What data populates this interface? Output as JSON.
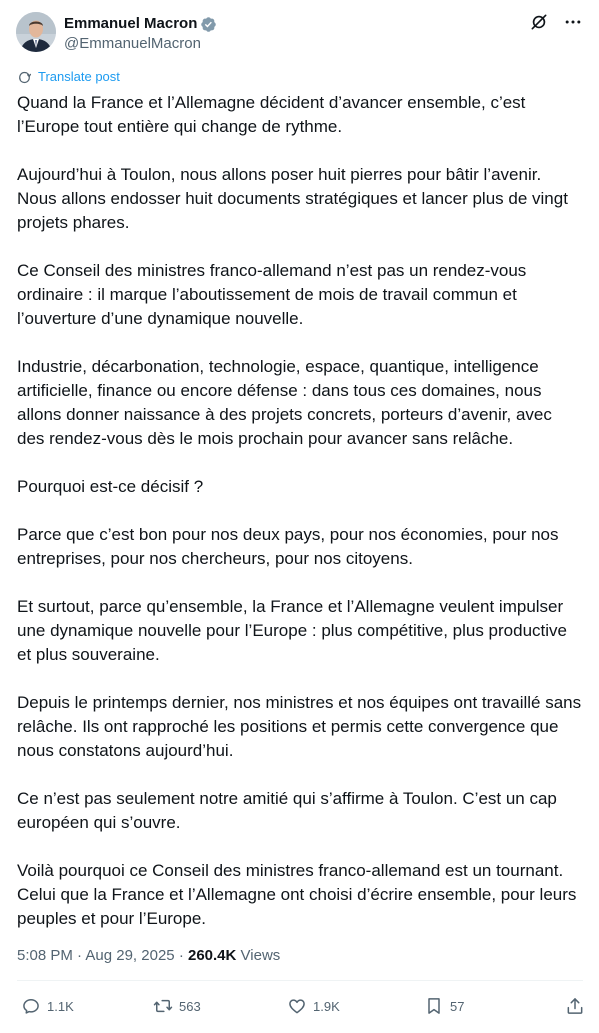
{
  "author": {
    "display_name": "Emmanuel Macron",
    "handle": "@EmmanuelMacron",
    "verified": true
  },
  "icons": {
    "avatar": "avatar-photo",
    "verified": "verified-badge-icon",
    "grok": "grok-icon",
    "more": "more-options-icon",
    "translate": "translate-icon",
    "reply": "reply-icon",
    "repost": "repost-icon",
    "like": "heart-icon",
    "bookmark": "bookmark-icon",
    "share": "share-icon"
  },
  "translate_label": "Translate post",
  "paragraphs": [
    "Quand la France et l’Allemagne décident d’avancer ensemble, c’est l’Europe tout entière qui change de rythme.",
    "Aujourd’hui à Toulon, nous allons poser huit pierres pour bâtir l’avenir. Nous allons endosser huit documents stratégiques et lancer plus de vingt projets phares.",
    "Ce Conseil des ministres franco-allemand n’est pas un rendez-vous ordinaire : il marque l’aboutissement de mois de travail commun et l’ouverture d’une dynamique nouvelle.",
    "Industrie, décarbonation, technologie, espace, quantique, intelligence artificielle, finance ou encore défense : dans tous ces domaines, nous allons donner naissance à des projets concrets, porteurs d’avenir, avec des rendez-vous dès le mois prochain pour avancer sans relâche.",
    "Pourquoi est-ce décisif ?",
    "Parce que c’est bon pour nos deux pays, pour nos économies, pour nos entreprises, pour nos chercheurs, pour nos citoyens.",
    "Et surtout, parce qu’ensemble, la France et l’Allemagne veulent impulser une dynamique nouvelle pour l’Europe : plus compétitive, plus productive et plus souveraine.",
    "Depuis le printemps dernier, nos ministres et nos équipes ont travaillé sans relâche. Ils ont rapproché les positions et permis cette convergence que nous constatons aujourd’hui.",
    "Ce n’est pas seulement notre amitié qui s’affirme à Toulon. C’est un cap européen qui s’ouvre.",
    "Voilà pourquoi ce Conseil des ministres franco-allemand est un tournant. Celui que la France et l’Allemagne ont choisi d’écrire ensemble, pour leurs peuples et pour l’Europe."
  ],
  "meta": {
    "time": "5:08 PM",
    "separator": "·",
    "date": "Aug 29, 2025",
    "views_count": "260.4K",
    "views_label": "Views"
  },
  "actions": {
    "replies": "1.1K",
    "reposts": "563",
    "likes": "1.9K",
    "bookmarks": "57"
  },
  "colors": {
    "text": "#0f1419",
    "secondary": "#536471",
    "link": "#1d9bf0",
    "verified": "#829aab",
    "divider": "#eff3f4"
  }
}
